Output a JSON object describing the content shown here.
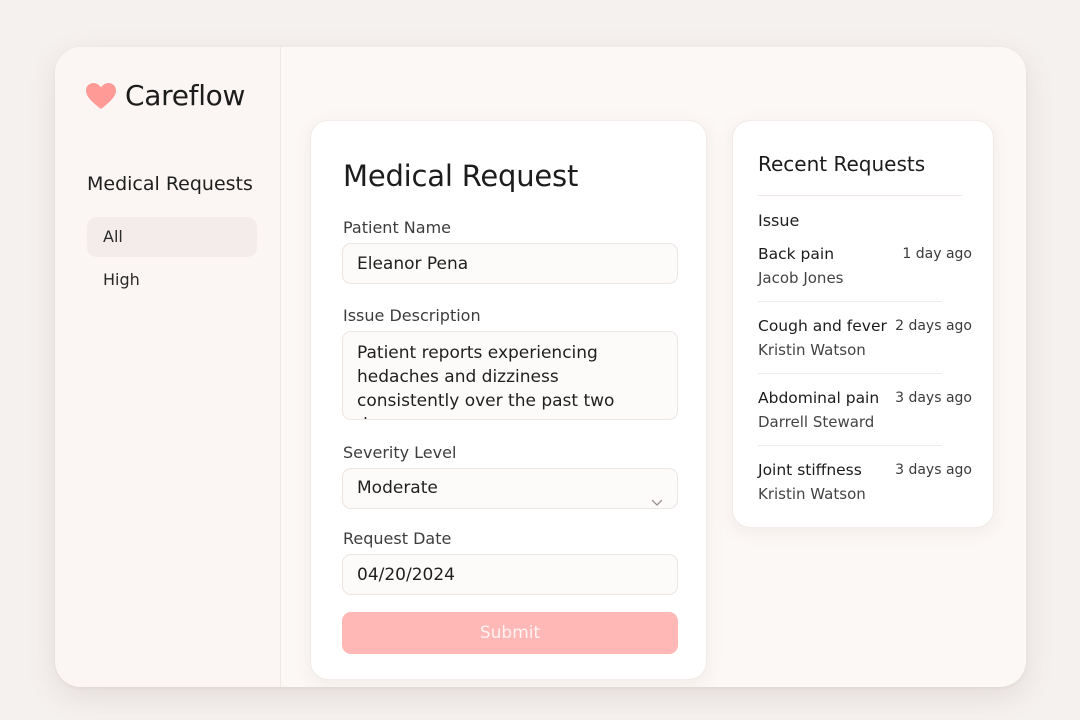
{
  "app": {
    "name": "Careflow",
    "brand_color": "#ff9a96"
  },
  "sidebar": {
    "title": "Medical Requests",
    "items": [
      {
        "label": "All",
        "active": true
      },
      {
        "label": "High",
        "active": false
      }
    ]
  },
  "form": {
    "title": "Medical Request",
    "patient_name": {
      "label": "Patient Name",
      "value": "Eleanor Pena"
    },
    "issue_description": {
      "label": "Issue Description",
      "value": "Patient reports experiencing hedaches and dizziness consistently over the past two days."
    },
    "severity": {
      "label": "Severity Level",
      "value": "Moderate",
      "icon": "chevron-down-icon"
    },
    "request_date": {
      "label": "Request Date",
      "value": "04/20/2024"
    },
    "submit_label": "Submit",
    "submit_color": "#ffb8b5"
  },
  "recent": {
    "title": "Recent Requests",
    "column_header": "Issue",
    "items": [
      {
        "issue": "Back pain",
        "time": "1 day ago",
        "name": "Jacob Jones"
      },
      {
        "issue": "Cough and fever",
        "time": "2 days ago",
        "name": "Kristin Watson"
      },
      {
        "issue": "Abdominal pain",
        "time": "3 days ago",
        "name": "Darrell Steward"
      },
      {
        "issue": "Joint stiffness",
        "time": "3 days ago",
        "name": "Kristin Watson"
      }
    ]
  }
}
